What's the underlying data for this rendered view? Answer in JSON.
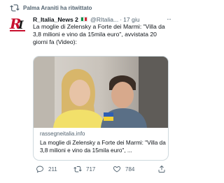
{
  "retweet": {
    "text": "Palma Araniti ha ritwittato",
    "icon": "retweet-icon"
  },
  "author": {
    "name": "R_Italia_News 2",
    "handle": "@RItalia...",
    "separator": "·",
    "time": "17 giu",
    "avatar_text": "RI"
  },
  "tweet": {
    "text": "La moglie di Zelensky a Forte dei Marmi: \"Villa da 3,8 milioni e vino da 15mila euro\", avvistata 20 giorni fa (Video):"
  },
  "card": {
    "domain": "rassegneitalia.info",
    "title": "La moglie di Zelensky a Forte dei Marmi: \"Villa da 3,8 milioni e vino da 15mila euro\", ..."
  },
  "actions": {
    "replies": "211",
    "retweets": "717",
    "likes": "784"
  },
  "colors": {
    "muted": "#536471",
    "text": "#0f1419",
    "border": "#cfd9de",
    "flag_green": "#009246",
    "flag_white": "#ffffff",
    "flag_red": "#ce2b37",
    "logo_red": "#c8102e"
  }
}
